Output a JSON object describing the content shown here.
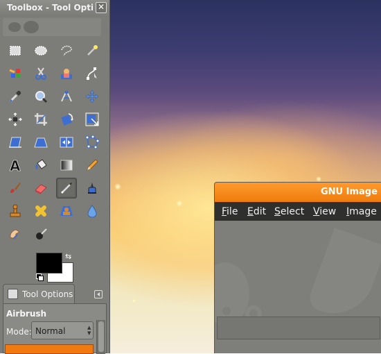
{
  "toolbox": {
    "title": "Toolbox - Tool Optio",
    "close_glyph": "✕",
    "tools": [
      {
        "name": "rectangle-select-icon"
      },
      {
        "name": "ellipse-select-icon"
      },
      {
        "name": "free-select-icon"
      },
      {
        "name": "fuzzy-select-icon"
      },
      {
        "name": "select-by-color-icon"
      },
      {
        "name": "scissors-select-icon"
      },
      {
        "name": "foreground-select-icon"
      },
      {
        "name": "paths-icon"
      },
      {
        "name": "color-picker-icon"
      },
      {
        "name": "zoom-icon"
      },
      {
        "name": "measure-icon"
      },
      {
        "name": "move-icon"
      },
      {
        "name": "align-icon"
      },
      {
        "name": "crop-icon"
      },
      {
        "name": "rotate-icon"
      },
      {
        "name": "scale-icon"
      },
      {
        "name": "shear-icon"
      },
      {
        "name": "perspective-icon"
      },
      {
        "name": "flip-icon"
      },
      {
        "name": "cage-transform-icon"
      },
      {
        "name": "text-icon"
      },
      {
        "name": "bucket-fill-icon"
      },
      {
        "name": "blend-icon"
      },
      {
        "name": "pencil-icon"
      },
      {
        "name": "paintbrush-icon"
      },
      {
        "name": "eraser-icon"
      },
      {
        "name": "airbrush-icon",
        "active": true
      },
      {
        "name": "ink-icon"
      },
      {
        "name": "clone-icon"
      },
      {
        "name": "heal-icon"
      },
      {
        "name": "perspective-clone-icon"
      },
      {
        "name": "blur-sharpen-icon"
      },
      {
        "name": "smudge-icon"
      },
      {
        "name": "dodge-burn-icon"
      }
    ],
    "colors": {
      "foreground": "#000000",
      "background": "#ffffff"
    }
  },
  "tool_options": {
    "tab_label": "Tool Options",
    "tool_name": "Airbrush",
    "mode_label": "Mode:",
    "mode_value": "Normal",
    "opacity_color": "#f07a10"
  },
  "main_window": {
    "title": "GNU Image M",
    "accent": "#f5860f",
    "menu": [
      {
        "label": "File"
      },
      {
        "label": "Edit"
      },
      {
        "label": "Select"
      },
      {
        "label": "View"
      },
      {
        "label": "Image"
      }
    ]
  }
}
